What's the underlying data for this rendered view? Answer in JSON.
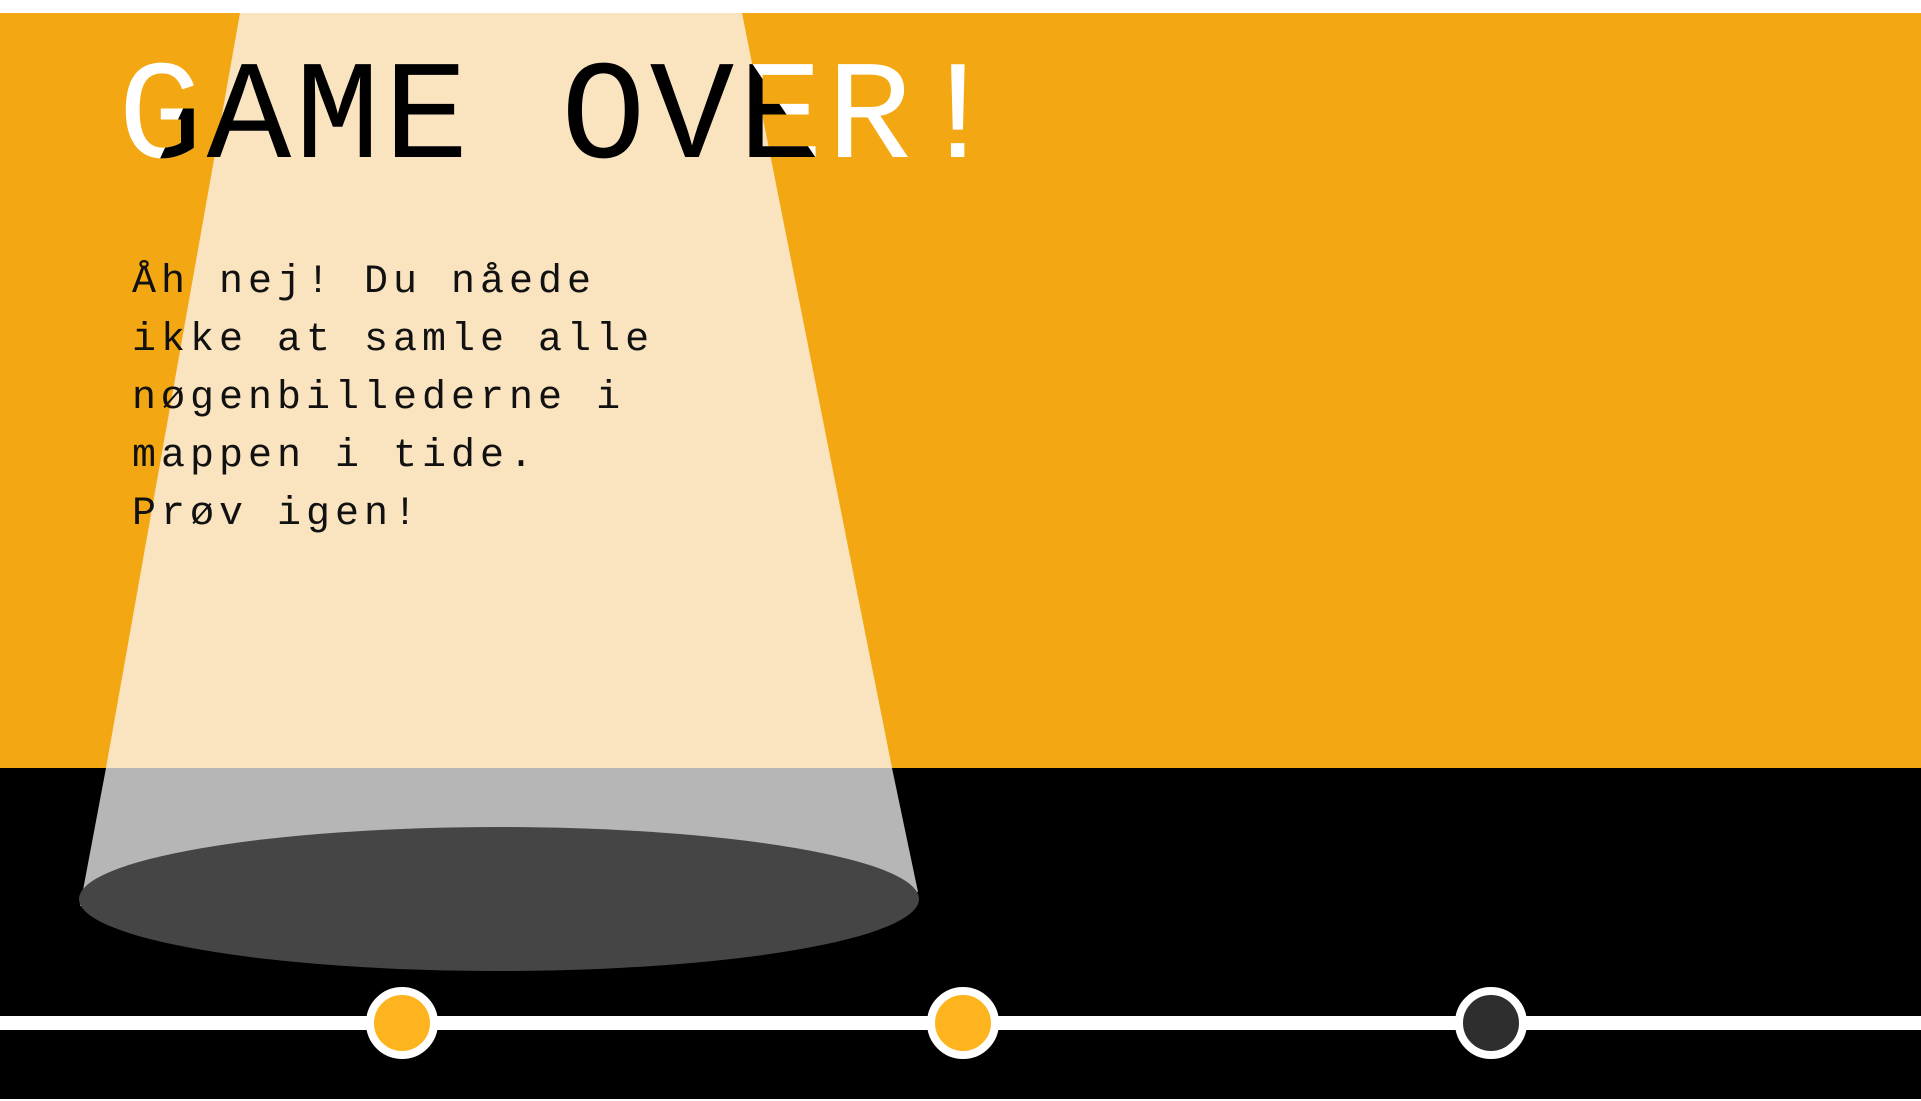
{
  "screen": {
    "title": "GAME OVER!",
    "message": "Åh nej! Du nåede\nikke at samle alle\nnøgenbillederne i\nmappen i tide.\nPrøv igen!"
  },
  "colors": {
    "background_orange": "#F3A813",
    "spotlight_beam": "#FAE3BF",
    "floor": "#000000",
    "beam_on_floor": "#B6B6B6",
    "spot_ellipse": "#454545",
    "track_line": "#FFFFFF",
    "node_completed": "#FDB41F",
    "node_current": "#2E2E2E"
  },
  "progress": {
    "total_levels": 3,
    "nodes": [
      {
        "state": "completed"
      },
      {
        "state": "completed"
      },
      {
        "state": "current"
      }
    ]
  }
}
